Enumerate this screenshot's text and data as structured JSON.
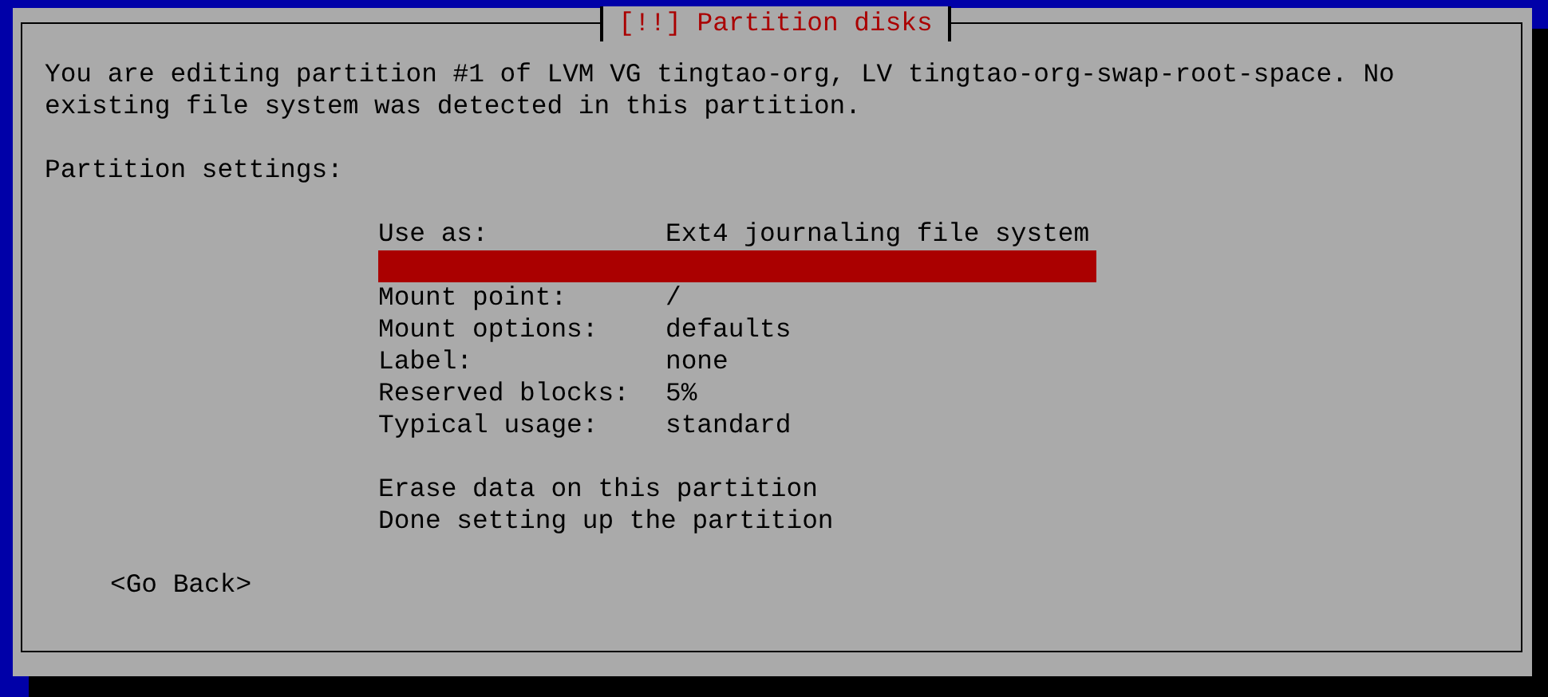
{
  "dialog": {
    "title": "[!!] Partition disks",
    "message": "You are editing partition #1 of LVM VG tingtao-org, LV tingtao-org-swap-root-space. No existing file system was detected in this partition.",
    "section_label": "Partition settings:",
    "items": [
      {
        "kind": "setting",
        "label": "Use as:",
        "value": "Ext4 journaling file system",
        "selected": false
      },
      {
        "kind": "blank",
        "selected": true
      },
      {
        "kind": "setting",
        "label": "Mount point:",
        "value": "/",
        "selected": false
      },
      {
        "kind": "setting",
        "label": "Mount options:",
        "value": "defaults",
        "selected": false
      },
      {
        "kind": "setting",
        "label": "Label:",
        "value": "none",
        "selected": false
      },
      {
        "kind": "setting",
        "label": "Reserved blocks:",
        "value": "5%",
        "selected": false
      },
      {
        "kind": "setting",
        "label": "Typical usage:",
        "value": "standard",
        "selected": false
      },
      {
        "kind": "blank",
        "selected": false
      },
      {
        "kind": "action",
        "label": "Erase data on this partition",
        "selected": false
      },
      {
        "kind": "action",
        "label": "Done setting up the partition",
        "selected": false
      }
    ],
    "back_button": "<Go Back>"
  }
}
